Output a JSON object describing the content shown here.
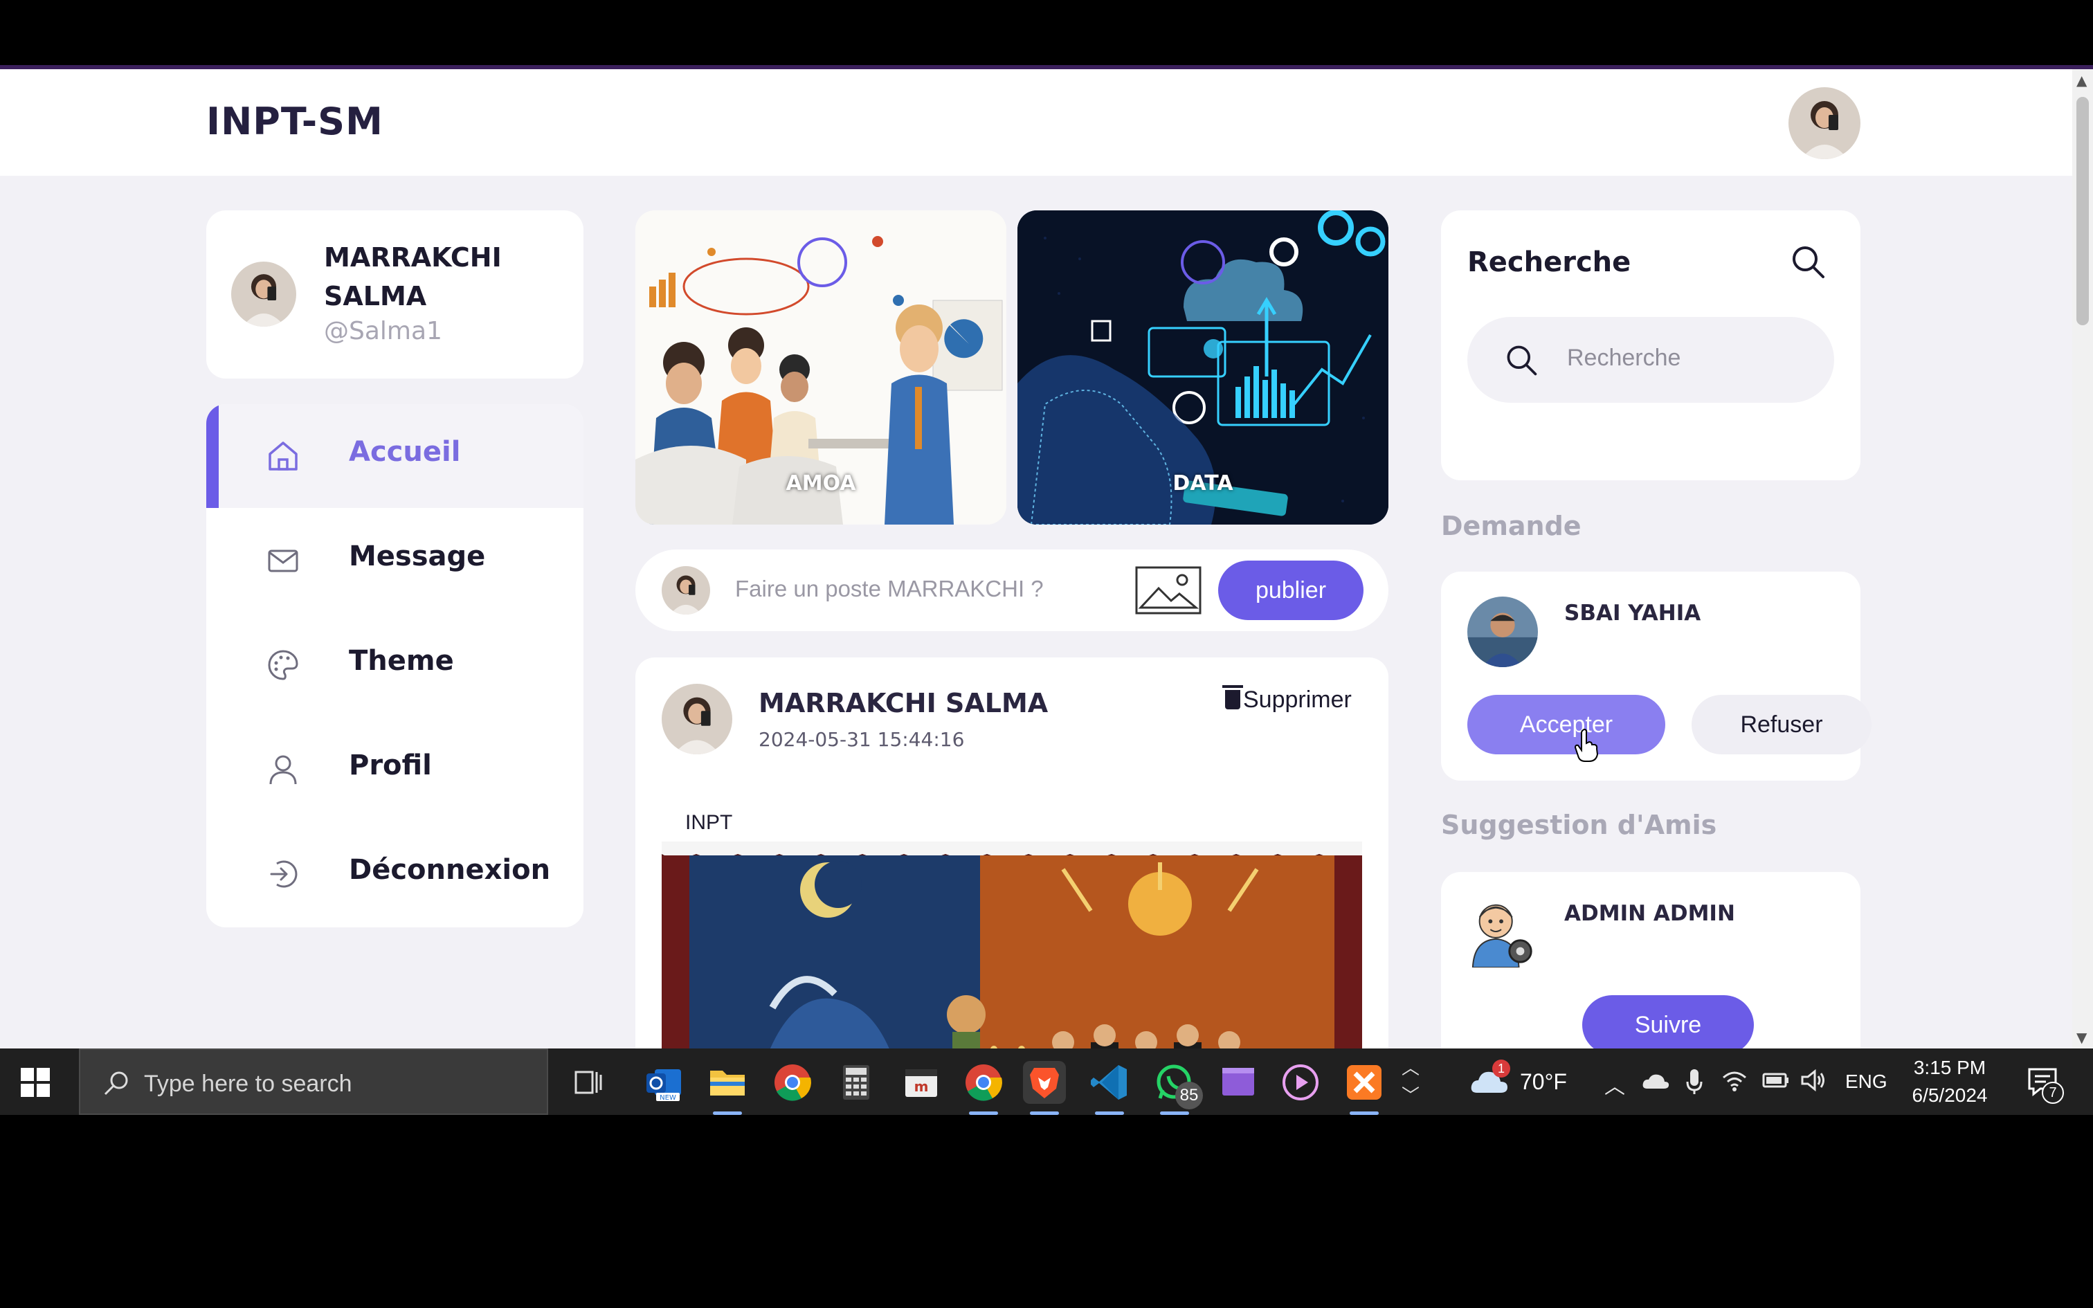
{
  "app": {
    "logo": "INPT-SM"
  },
  "profile": {
    "name": "MARRAKCHI SALMA",
    "handle": "@Salma1"
  },
  "menu": {
    "items": [
      {
        "label": "Accueil",
        "icon": "home-icon",
        "active": true
      },
      {
        "label": "Message",
        "icon": "mail-icon",
        "active": false
      },
      {
        "label": "Theme",
        "icon": "palette-icon",
        "active": false
      },
      {
        "label": "Profil",
        "icon": "user-icon",
        "active": false
      },
      {
        "label": "Déconnexion",
        "icon": "logout-icon",
        "active": false
      }
    ]
  },
  "banners": [
    {
      "label": "AMOA"
    },
    {
      "label": "DATA"
    }
  ],
  "create_post": {
    "placeholder": "Faire un poste MARRAKCHI ?",
    "publish_label": "publier"
  },
  "post": {
    "author": "MARRAKCHI SALMA",
    "date": "2024-05-31 15:44:16",
    "delete_label": "Supprimer",
    "text": "INPT"
  },
  "search": {
    "title": "Recherche",
    "placeholder": "Recherche"
  },
  "requests": {
    "title": "Demande",
    "items": [
      {
        "name": "SBAI YAHIA",
        "accept_label": "Accepter",
        "refuse_label": "Refuser"
      }
    ]
  },
  "suggestions": {
    "title": "Suggestion d'Amis",
    "items": [
      {
        "name": "ADMIN ADMIN",
        "follow_label": "Suivre"
      }
    ]
  },
  "taskbar": {
    "search_placeholder": "Type here to search",
    "whatsapp_badge": "85",
    "weather_badge": "1",
    "temperature": "70°F",
    "language": "ENG",
    "time": "3:15 PM",
    "date": "6/5/2024",
    "notification_count": "7"
  },
  "colors": {
    "accent": "#6b5ce7",
    "accent_light": "#8a7ff0",
    "background": "#f2f1f6"
  }
}
